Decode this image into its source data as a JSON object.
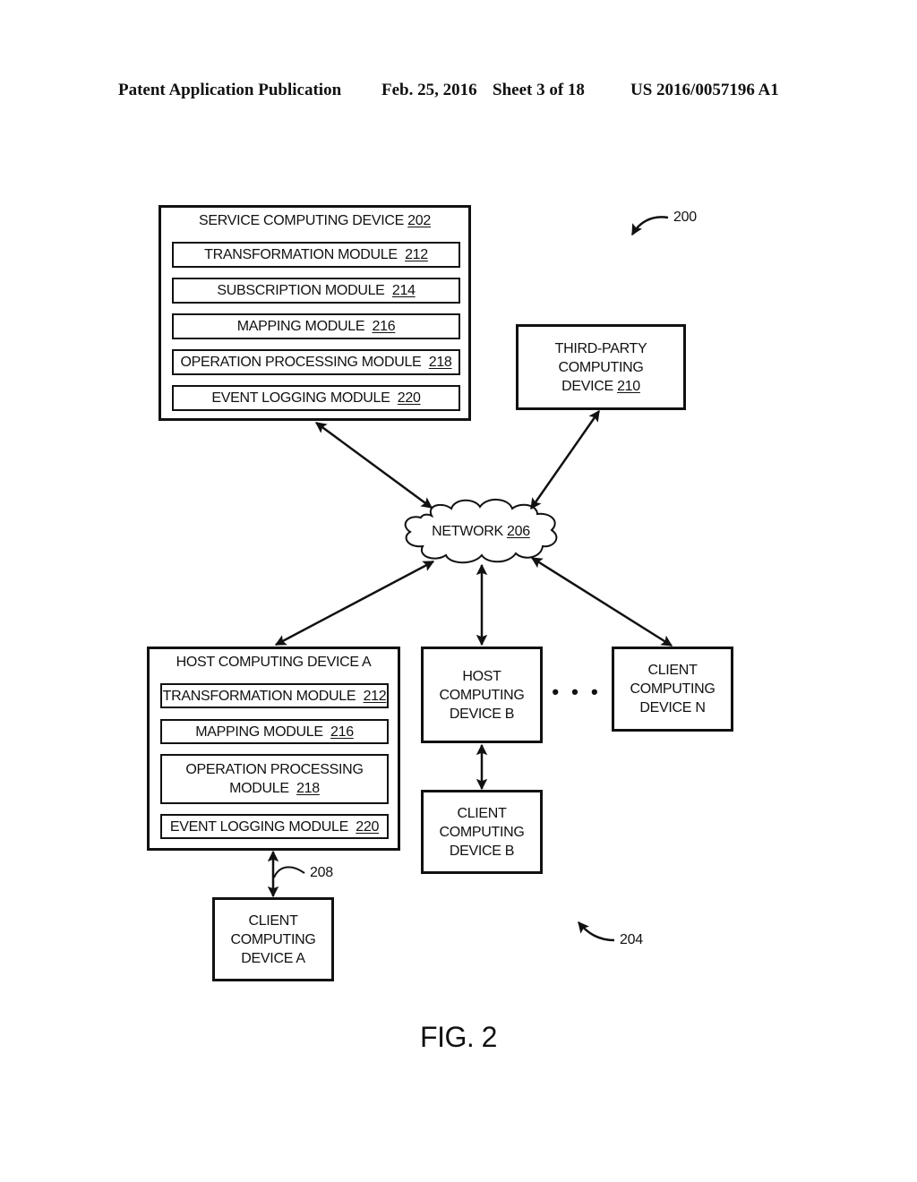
{
  "header": {
    "publication": "Patent Application Publication",
    "date": "Feb. 25, 2016",
    "sheet": "Sheet 3 of 18",
    "patent_number": "US 2016/0057196 A1"
  },
  "figure_label": "FIG. 2",
  "reference_labels": {
    "system": "200",
    "client_group": "204",
    "connection": "208"
  },
  "service_device": {
    "title": "SERVICE COMPUTING DEVICE",
    "ref": "202",
    "modules": [
      {
        "name": "TRANSFORMATION MODULE",
        "ref": "212"
      },
      {
        "name": "SUBSCRIPTION MODULE",
        "ref": "214"
      },
      {
        "name": "MAPPING MODULE",
        "ref": "216"
      },
      {
        "name": "OPERATION PROCESSING MODULE",
        "ref": "218"
      },
      {
        "name": "EVENT LOGGING MODULE",
        "ref": "220"
      }
    ]
  },
  "third_party_device": {
    "lines": [
      "THIRD-PARTY",
      "COMPUTING",
      "DEVICE"
    ],
    "ref": "210"
  },
  "network": {
    "name": "NETWORK",
    "ref": "206"
  },
  "host_device_a": {
    "title": "HOST COMPUTING DEVICE A",
    "modules": [
      {
        "name": "TRANSFORMATION MODULE",
        "ref": "212"
      },
      {
        "name": "MAPPING MODULE",
        "ref": "216"
      },
      {
        "name_line1": "OPERATION PROCESSING",
        "name_line2": "MODULE",
        "ref": "218"
      },
      {
        "name": "EVENT LOGGING MODULE",
        "ref": "220"
      }
    ]
  },
  "host_device_b": {
    "lines": [
      "HOST",
      "COMPUTING",
      "DEVICE B"
    ]
  },
  "client_device_n": {
    "lines": [
      "CLIENT",
      "COMPUTING",
      "DEVICE N"
    ]
  },
  "client_device_b": {
    "lines": [
      "CLIENT",
      "COMPUTING",
      "DEVICE B"
    ]
  },
  "client_device_a": {
    "lines": [
      "CLIENT",
      "COMPUTING",
      "DEVICE A"
    ]
  },
  "ellipsis": "• • •"
}
